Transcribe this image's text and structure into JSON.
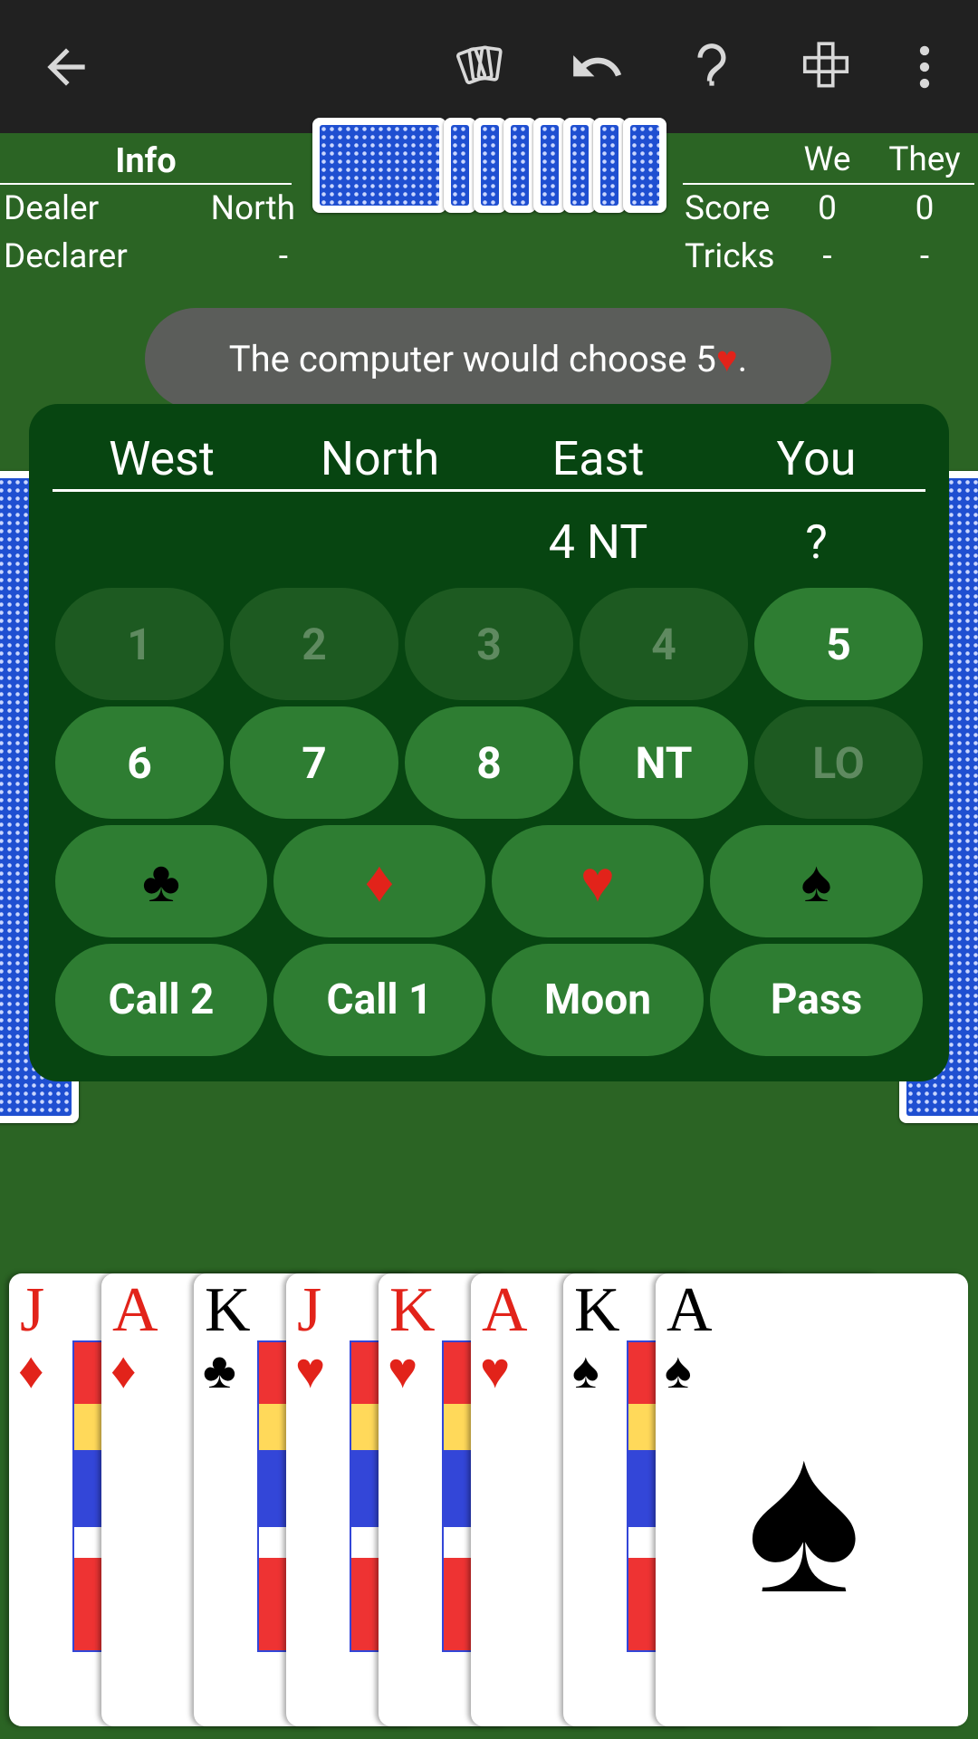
{
  "toolbar": {
    "back_icon": "arrow-left-icon",
    "cards_icon": "cards-icon",
    "undo_icon": "undo-icon",
    "help_icon": "question-icon",
    "layout_icon": "layout-icon",
    "more_icon": "more-vert-icon"
  },
  "info": {
    "title": "Info",
    "rows": [
      {
        "label": "Dealer",
        "value": "North"
      },
      {
        "label": "Declarer",
        "value": "-"
      }
    ]
  },
  "score": {
    "col1": "We",
    "col2": "They",
    "rows": [
      {
        "label": "Score",
        "we": "0",
        "they": "0"
      },
      {
        "label": "Tricks",
        "we": "-",
        "they": "-"
      }
    ]
  },
  "toast": {
    "text": "The computer would choose 5",
    "suit": "♥",
    "end": "."
  },
  "bidding": {
    "players": [
      "West",
      "North",
      "East",
      "You"
    ],
    "last_bids": [
      "",
      "",
      "4 NT",
      "?"
    ],
    "numbers": [
      {
        "label": "1",
        "enabled": false
      },
      {
        "label": "2",
        "enabled": false
      },
      {
        "label": "3",
        "enabled": false
      },
      {
        "label": "4",
        "enabled": false
      },
      {
        "label": "5",
        "enabled": true
      },
      {
        "label": "6",
        "enabled": true
      },
      {
        "label": "7",
        "enabled": true
      },
      {
        "label": "8",
        "enabled": true
      },
      {
        "label": "NT",
        "enabled": true
      },
      {
        "label": "LO",
        "enabled": false
      }
    ],
    "suits": [
      "♣",
      "♦",
      "♥",
      "♠"
    ],
    "actions": [
      "Call 2",
      "Call 1",
      "Moon",
      "Pass"
    ]
  },
  "hand": [
    {
      "rank": "J",
      "suit": "♦",
      "color": "red"
    },
    {
      "rank": "A",
      "suit": "♦",
      "color": "red"
    },
    {
      "rank": "K",
      "suit": "♣",
      "color": "black"
    },
    {
      "rank": "J",
      "suit": "♥",
      "color": "red"
    },
    {
      "rank": "K",
      "suit": "♥",
      "color": "red"
    },
    {
      "rank": "A",
      "suit": "♥",
      "color": "red"
    },
    {
      "rank": "K",
      "suit": "♠",
      "color": "black"
    },
    {
      "rank": "A",
      "suit": "♠",
      "color": "black"
    }
  ]
}
